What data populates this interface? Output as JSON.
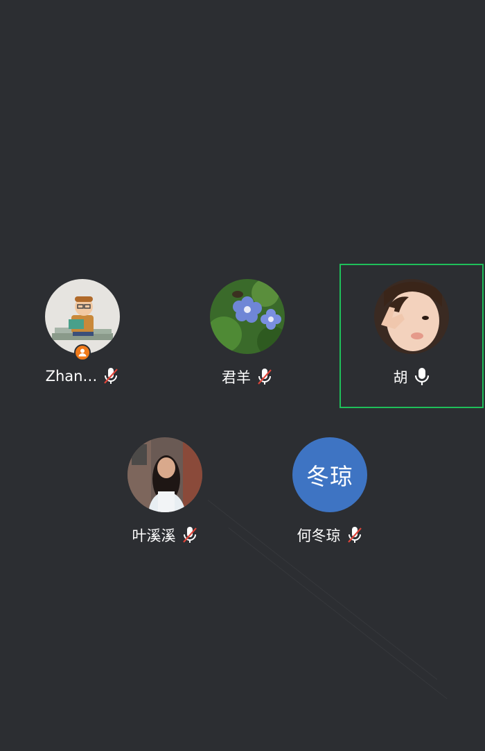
{
  "participants": [
    {
      "name": "Zhan…",
      "initials": "",
      "mic": "muted",
      "speaking": false,
      "host": true,
      "avatar_icon": "reader-cartoon-avatar"
    },
    {
      "name": "君羊",
      "initials": "",
      "mic": "muted",
      "speaking": false,
      "host": false,
      "avatar_icon": "blue-flower-photo-avatar"
    },
    {
      "name": "胡",
      "initials": "",
      "mic": "on",
      "speaking": true,
      "host": false,
      "avatar_icon": "child-photo-avatar"
    },
    {
      "name": "叶溪溪",
      "initials": "",
      "mic": "muted",
      "speaking": false,
      "host": false,
      "avatar_icon": "woman-photo-avatar"
    },
    {
      "name": "何冬琼",
      "initials": "冬琼",
      "mic": "muted",
      "speaking": false,
      "host": false,
      "avatar_icon": "initials-avatar"
    }
  ],
  "colors": {
    "background": "#2c2e32",
    "speaking_border": "#1fbf5a",
    "host_badge": "#f07a1a",
    "initials_avatar": "#3e74c3",
    "mute_slash": "#e0453a"
  }
}
